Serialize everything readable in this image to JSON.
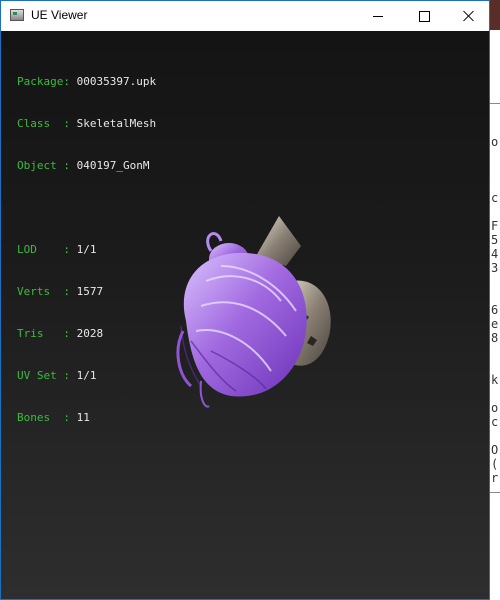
{
  "window": {
    "title": "UE Viewer",
    "controls": {
      "minimize": "minimize",
      "maximize": "maximize",
      "close": "close"
    }
  },
  "info": {
    "package": {
      "label": "Package:",
      "value": "00035397.upk"
    },
    "class": {
      "label": "Class  :",
      "value": "SkeletalMesh"
    },
    "object": {
      "label": "Object :",
      "value": "040197_GonM"
    },
    "lod": {
      "label": "LOD    :",
      "value": "1/1"
    },
    "verts": {
      "label": "Verts  :",
      "value": "1577"
    },
    "tris": {
      "label": "Tris   :",
      "value": "2028"
    },
    "uvset": {
      "label": "UV Set :",
      "value": "1/1"
    },
    "bones": {
      "label": "Bones  :",
      "value": "11"
    }
  },
  "background_window": {
    "text": "o\n\n\n\nc\n\nF\n5\n4\n3\n\n\n6\ne\n8\n\n\nk\n\no\nc\n\nO\n(\nr"
  },
  "colors": {
    "label": "#3dbb3d",
    "value": "#e8e8e8",
    "hair": "#a26ae0",
    "accent_border": "#1e6fbf"
  },
  "viewport": {
    "model_name": "hair mesh"
  }
}
